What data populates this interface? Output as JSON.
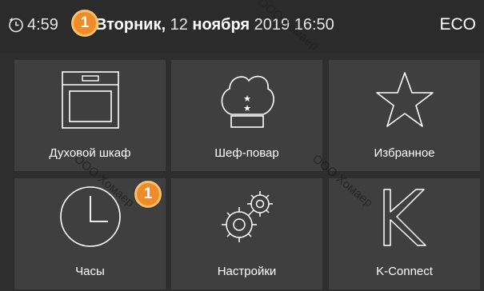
{
  "topbar": {
    "time": "4:59",
    "time_badge": "1",
    "date_weekday": "Вторник,",
    "date_day": "12",
    "date_month": "ноября",
    "date_year": "2019",
    "date_time": "16:50",
    "eco_label": "ECO"
  },
  "tiles": [
    {
      "label": "Духовой шкаф",
      "icon": "oven-icon"
    },
    {
      "label": "Шеф-повар",
      "icon": "chef-hat-icon"
    },
    {
      "label": "Избранное",
      "icon": "star-icon"
    },
    {
      "label": "Часы",
      "icon": "clock-icon",
      "badge": "1"
    },
    {
      "label": "Настройки",
      "icon": "gears-icon"
    },
    {
      "label": "K-Connect",
      "icon": "k-connect-icon"
    }
  ],
  "watermark": "ООО Хомаер",
  "colors": {
    "badge": "#ee8b2a",
    "tile": "#3f3f3f",
    "background": "#2e2e2e"
  }
}
